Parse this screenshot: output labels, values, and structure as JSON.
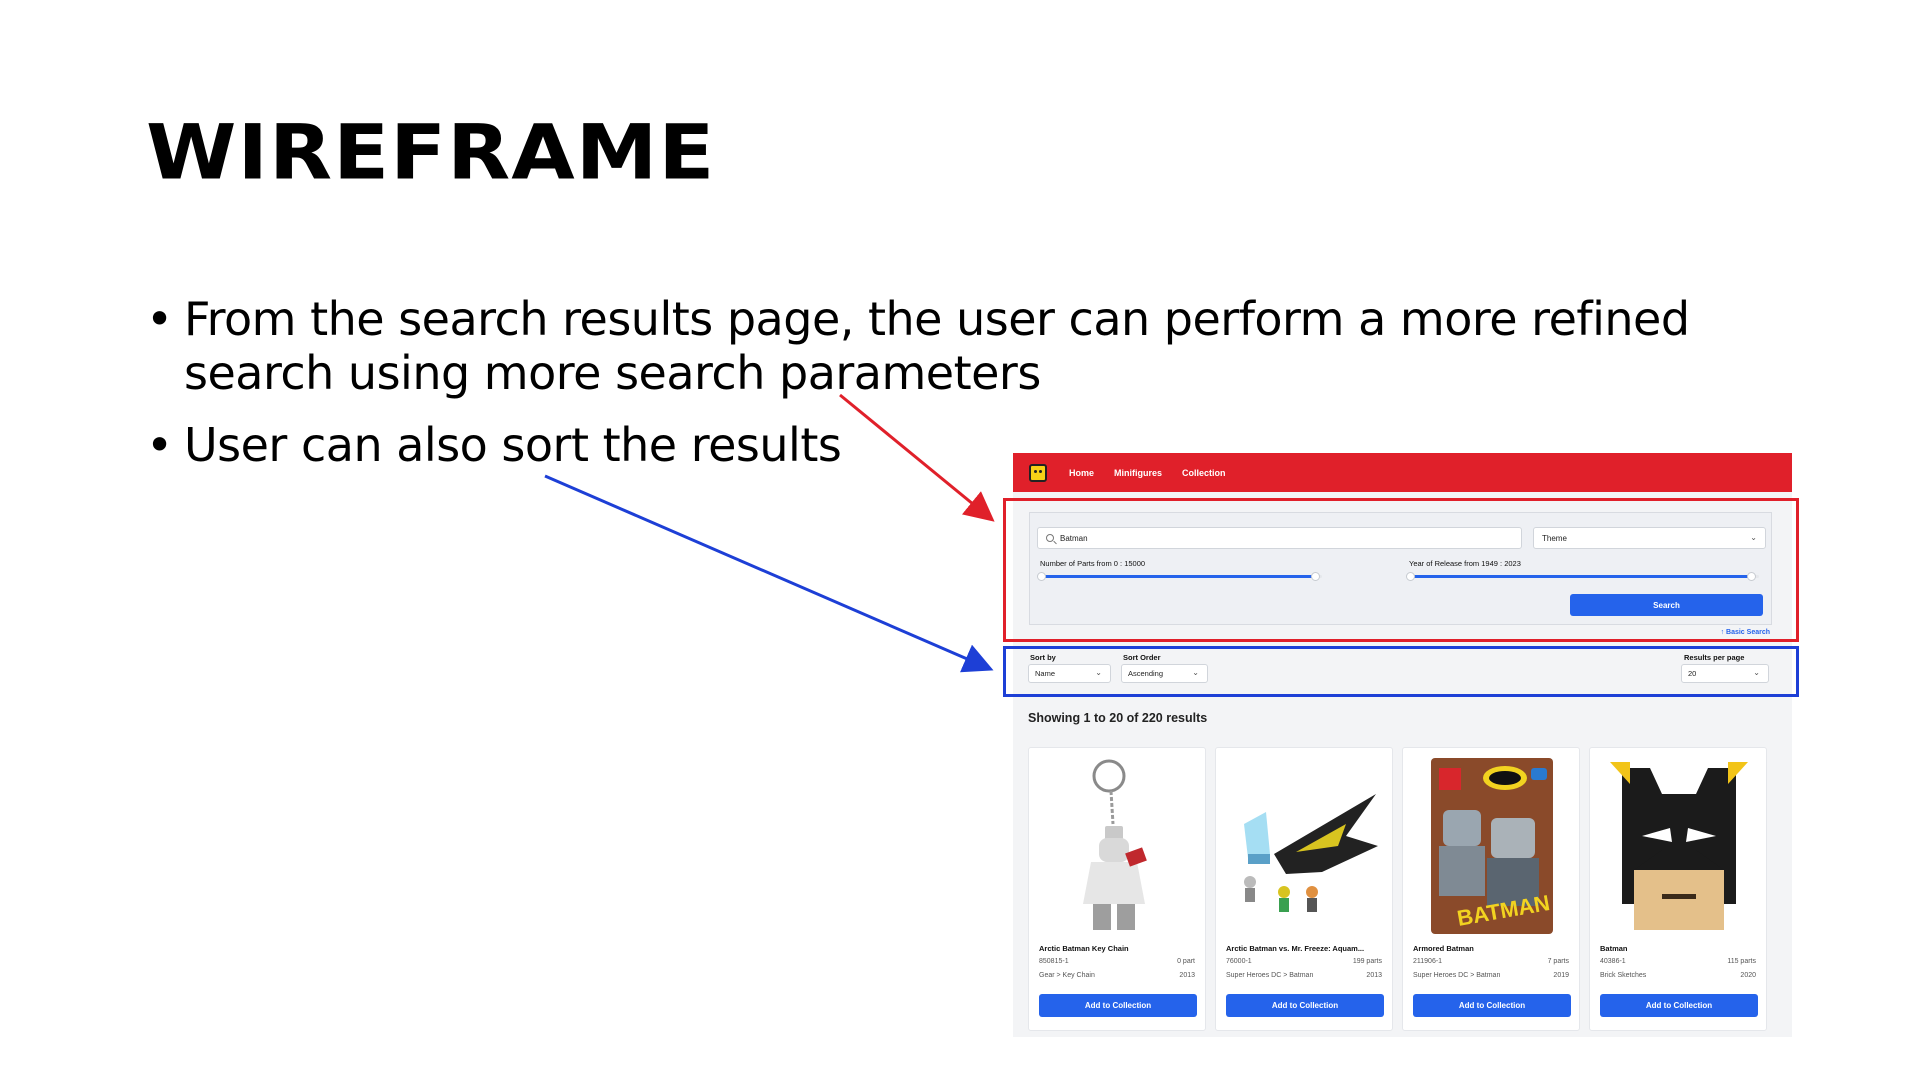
{
  "slide": {
    "title": "WIREFRAME",
    "bullets": [
      "From the search results page, the user can perform a more refined search using more search parameters",
      "User can also sort the results"
    ]
  },
  "app": {
    "nav": {
      "logo_icon": "lego-head-icon",
      "links": [
        "Home",
        "Minifigures",
        "Collection"
      ]
    },
    "search": {
      "query_value": "Batman",
      "theme_placeholder": "Theme",
      "parts_label": "Number of Parts from 0 : 15000",
      "parts_fill": 0.98,
      "year_label": "Year of Release from 1949 : 2023",
      "year_fill": 0.98,
      "search_button": "Search",
      "basic_search_link": "↑ Basic Search"
    },
    "sort": {
      "sort_by_label": "Sort by",
      "sort_by_value": "Name",
      "sort_order_label": "Sort Order",
      "sort_order_value": "Ascending",
      "per_page_label": "Results per page",
      "per_page_value": "20"
    },
    "results_heading": "Showing 1 to 20 of 220 results",
    "results": [
      {
        "name": "Arctic Batman Key Chain",
        "set_number": "850815-1",
        "parts": "0 part",
        "theme": "Gear > Key Chain",
        "year": "2013",
        "button": "Add to Collection",
        "image_icon": "keychain-minifigure-icon"
      },
      {
        "name": "Arctic Batman vs. Mr. Freeze: Aquam...",
        "set_number": "76000-1",
        "parts": "199 parts",
        "theme": "Super Heroes DC > Batman",
        "year": "2013",
        "button": "Add to Collection",
        "image_icon": "batwing-set-icon"
      },
      {
        "name": "Armored Batman",
        "set_number": "211906-1",
        "parts": "7 parts",
        "theme": "Super Heroes DC > Batman",
        "year": "2019",
        "button": "Add to Collection",
        "image_icon": "foil-pack-icon"
      },
      {
        "name": "Batman",
        "set_number": "40386-1",
        "parts": "115 parts",
        "theme": "Brick Sketches",
        "year": "2020",
        "button": "Add to Collection",
        "image_icon": "batman-brick-sketch-icon"
      }
    ],
    "colors": {
      "nav": "#e0202a",
      "primary": "#2563eb",
      "highlight_search": "#e0202a",
      "highlight_sort": "#1d3fd6"
    }
  }
}
